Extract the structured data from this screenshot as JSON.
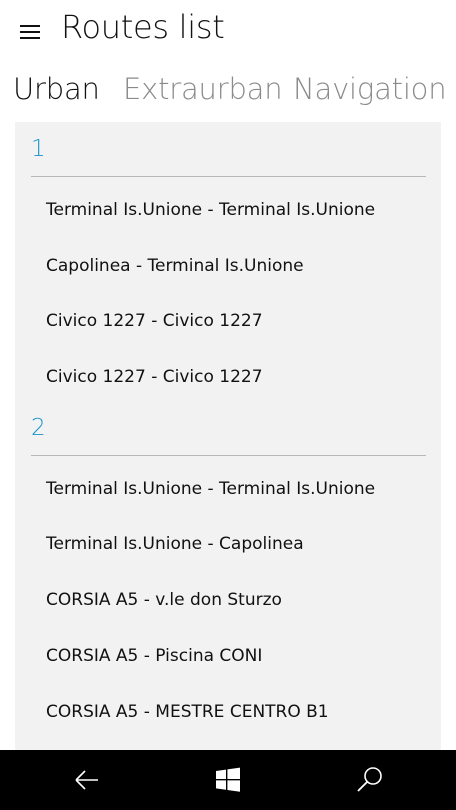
{
  "header": {
    "title": "Routes list",
    "menu_icon": "hamburger-menu-icon"
  },
  "tabs": [
    {
      "label": "Urban",
      "active": true
    },
    {
      "label": "Extraurban",
      "active": false
    },
    {
      "label": "Navigation",
      "active": false
    }
  ],
  "groups": [
    {
      "number": "1",
      "routes": [
        "Terminal Is.Unione - Terminal Is.Unione",
        "Capolinea - Terminal Is.Unione",
        "Civico 1227 - Civico 1227",
        "Civico 1227 - Civico 1227"
      ]
    },
    {
      "number": "2",
      "routes": [
        "Terminal Is.Unione - Terminal Is.Unione",
        "Terminal Is.Unione - Capolinea",
        "CORSIA A5 - v.le don Sturzo",
        "CORSIA A5 - Piscina CONI",
        "CORSIA A5 - MESTRE CENTRO B1"
      ]
    }
  ],
  "navbar": {
    "back_icon": "back-arrow-icon",
    "home_icon": "windows-logo-icon",
    "search_icon": "search-icon"
  },
  "colors": {
    "accent": "#1a94c9",
    "panel": "#f2f2f2",
    "navbar": "#000000"
  }
}
